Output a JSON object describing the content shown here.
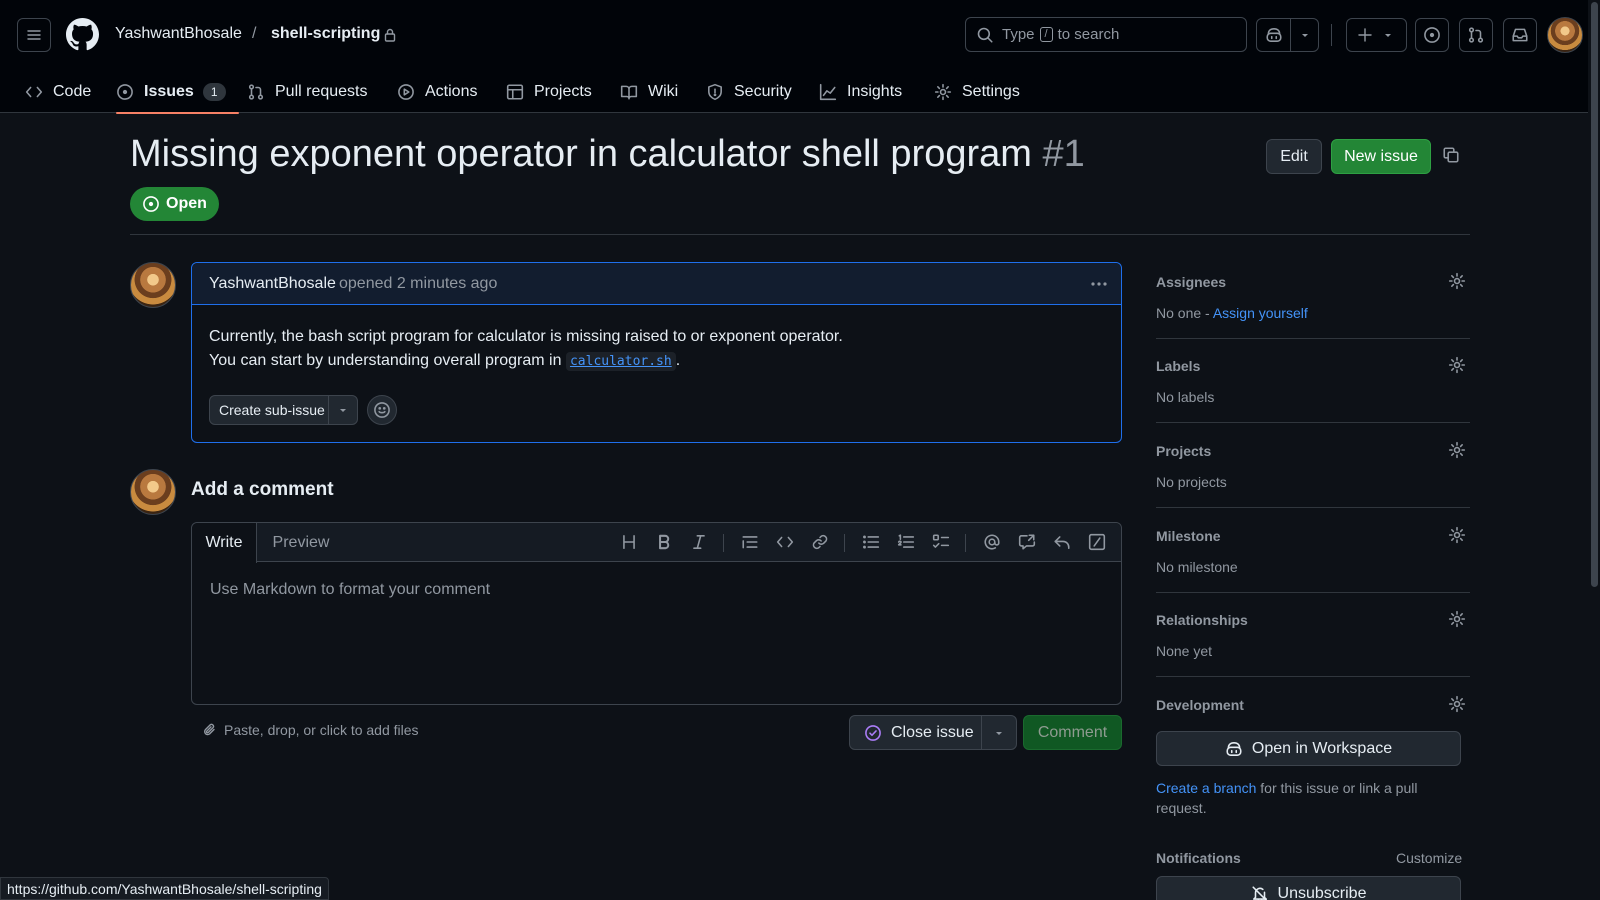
{
  "header": {
    "owner": "YashwantBhosale",
    "separator": "/",
    "repo": "shell-scripting",
    "search_prefix": "Type",
    "search_key": "/",
    "search_suffix": "to search"
  },
  "tabs": [
    {
      "label": "Code",
      "icon": "code-icon"
    },
    {
      "label": "Issues",
      "icon": "issue-opened-icon",
      "count": "1",
      "active": true
    },
    {
      "label": "Pull requests",
      "icon": "git-pull-request-icon"
    },
    {
      "label": "Actions",
      "icon": "play-icon"
    },
    {
      "label": "Projects",
      "icon": "table-icon"
    },
    {
      "label": "Wiki",
      "icon": "book-icon"
    },
    {
      "label": "Security",
      "icon": "shield-icon"
    },
    {
      "label": "Insights",
      "icon": "graph-icon"
    },
    {
      "label": "Settings",
      "icon": "gear-icon"
    }
  ],
  "issue": {
    "title": "Missing exponent operator in calculator shell program",
    "number": "#1",
    "state": "Open",
    "edit_label": "Edit",
    "new_issue_label": "New issue"
  },
  "comment": {
    "author": "YashwantBhosale",
    "meta": "opened 2 minutes ago",
    "line1": "Currently, the bash script program for calculator is missing raised to or exponent operator.",
    "line2_prefix": "You can start by understanding overall program in",
    "code": "calculator.sh",
    "line2_suffix": ".",
    "subissue_label": "Create sub-issue"
  },
  "editor": {
    "heading": "Add a comment",
    "tab_write": "Write",
    "tab_preview": "Preview",
    "placeholder": "Use Markdown to format your comment",
    "attach_text": "Paste, drop, or click to add files",
    "close_label": "Close issue",
    "comment_label": "Comment"
  },
  "sidebar": {
    "assignees": {
      "heading": "Assignees",
      "value": "No one -",
      "link": "Assign yourself"
    },
    "labels": {
      "heading": "Labels",
      "value": "No labels"
    },
    "projects": {
      "heading": "Projects",
      "value": "No projects"
    },
    "milestone": {
      "heading": "Milestone",
      "value": "No milestone"
    },
    "relationships": {
      "heading": "Relationships",
      "value": "None yet"
    },
    "development": {
      "heading": "Development",
      "workspace_label": "Open in Workspace",
      "branch_link": "Create a branch",
      "text_suffix": "for this issue or link a pull request."
    },
    "notifications": {
      "heading": "Notifications",
      "customize": "Customize",
      "unsubscribe_label": "Unsubscribe"
    }
  },
  "status_url": "https://github.com/YashwantBhosale/shell-scripting",
  "colors": {
    "accent_green": "#238636",
    "link_blue": "#4493f8",
    "tab_underline": "#f78166",
    "background": "#0d1117"
  }
}
